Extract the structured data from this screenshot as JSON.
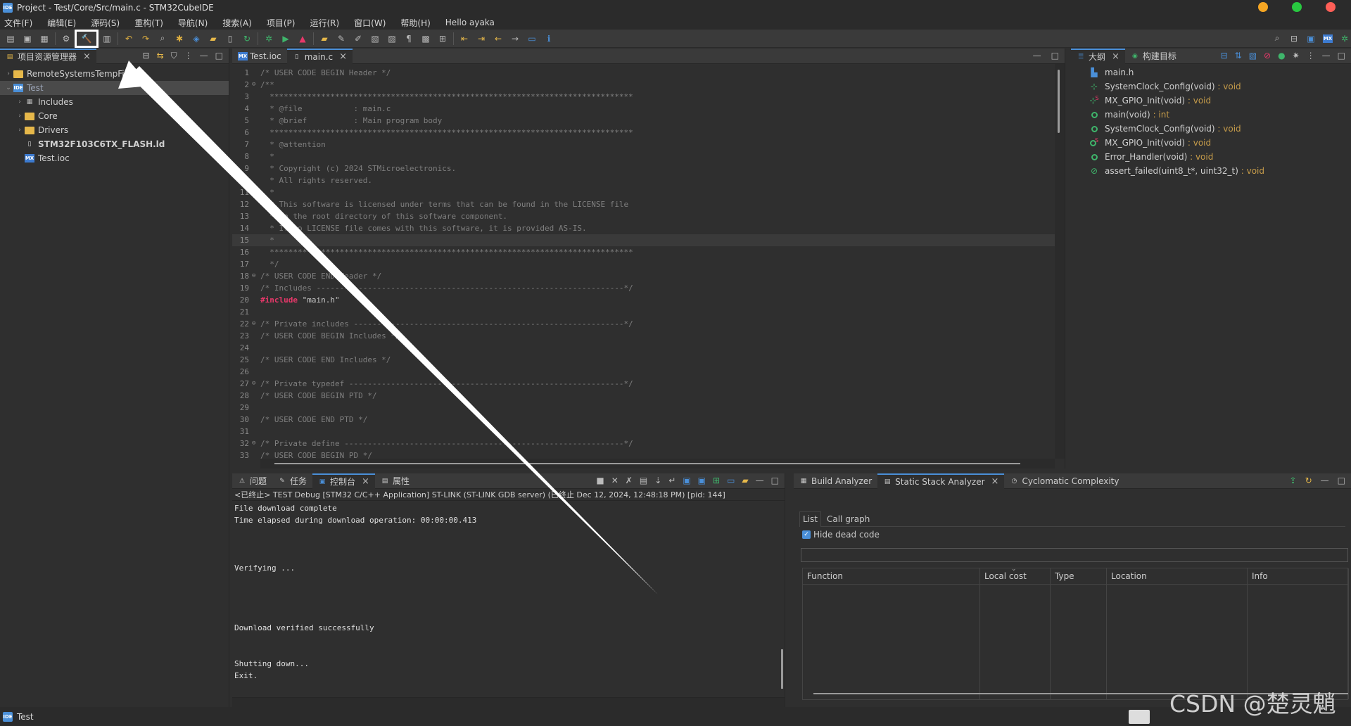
{
  "window": {
    "title": "Project - Test/Core/Src/main.c - STM32CubeIDE",
    "app_badge": "IDE",
    "controls": [
      "minimize",
      "maximize",
      "close"
    ],
    "control_colors": [
      "#f5a623",
      "#28c840",
      "#ff5f57"
    ]
  },
  "menu": [
    "文件(F)",
    "编辑(E)",
    "源码(S)",
    "重构(T)",
    "导航(N)",
    "搜索(A)",
    "项目(P)",
    "运行(R)",
    "窗口(W)",
    "帮助(H)",
    "Hello ayaka"
  ],
  "project_explorer": {
    "tab_label": "项目资源管理器",
    "items": [
      {
        "label": "RemoteSystemsTempFiles",
        "icon": "folder-icon",
        "level": 0,
        "caret": "›"
      },
      {
        "label": "Test",
        "icon": "ide-project-icon",
        "level": 0,
        "caret": "⌄",
        "selected": true
      },
      {
        "label": "Includes",
        "icon": "includes-icon",
        "level": 1,
        "caret": "›"
      },
      {
        "label": "Core",
        "icon": "folder-icon",
        "level": 1,
        "caret": "›"
      },
      {
        "label": "Drivers",
        "icon": "folder-icon",
        "level": 1,
        "caret": "›"
      },
      {
        "label": "STM32F103C6TX_FLASH.ld",
        "icon": "ld-file-icon",
        "level": 1,
        "caret": "",
        "bold": true
      },
      {
        "label": "Test.ioc",
        "icon": "mx-file-icon",
        "level": 1,
        "caret": ""
      }
    ]
  },
  "editor": {
    "tabs": [
      {
        "label": "Test.ioc",
        "icon": "mx-file-icon",
        "active": false
      },
      {
        "label": "main.c",
        "icon": "c-file-icon",
        "active": true
      }
    ],
    "lines": [
      {
        "n": "1",
        "fold": "",
        "text": "/* USER CODE BEGIN Header */"
      },
      {
        "n": "2",
        "fold": "⊖",
        "text": "/**"
      },
      {
        "n": "3",
        "fold": "",
        "text": "  ******************************************************************************"
      },
      {
        "n": "4",
        "fold": "",
        "text": "  * @file           : main.c"
      },
      {
        "n": "5",
        "fold": "",
        "text": "  * @brief          : Main program body"
      },
      {
        "n": "6",
        "fold": "",
        "text": "  ******************************************************************************"
      },
      {
        "n": "7",
        "fold": "",
        "text": "  * @attention"
      },
      {
        "n": "8",
        "fold": "",
        "text": "  *"
      },
      {
        "n": "9",
        "fold": "",
        "text": "  * Copyright (c) 2024 STMicroelectronics."
      },
      {
        "n": "10",
        "fold": "",
        "text": "  * All rights reserved."
      },
      {
        "n": "11",
        "fold": "",
        "text": "  *"
      },
      {
        "n": "12",
        "fold": "",
        "text": "  * This software is licensed under terms that can be found in the LICENSE file"
      },
      {
        "n": "13",
        "fold": "",
        "text": "  * in the root directory of this software component."
      },
      {
        "n": "14",
        "fold": "",
        "text": "  * If no LICENSE file comes with this software, it is provided AS-IS."
      },
      {
        "n": "15",
        "fold": "",
        "text": "  *"
      },
      {
        "n": "16",
        "fold": "",
        "text": "  ******************************************************************************"
      },
      {
        "n": "17",
        "fold": "",
        "text": "  */"
      },
      {
        "n": "18",
        "fold": "⊖",
        "text": "/* USER CODE END Header */"
      },
      {
        "n": "19",
        "fold": "",
        "text": "/* Includes ------------------------------------------------------------------*/"
      },
      {
        "n": "20",
        "fold": "",
        "text": "#include \"main.h\"",
        "kw": "#include",
        "rest": " \"main.h\""
      },
      {
        "n": "21",
        "fold": "",
        "text": ""
      },
      {
        "n": "22",
        "fold": "⊖",
        "text": "/* Private includes ----------------------------------------------------------*/"
      },
      {
        "n": "23",
        "fold": "",
        "text": "/* USER CODE BEGIN Includes */"
      },
      {
        "n": "24",
        "fold": "",
        "text": ""
      },
      {
        "n": "25",
        "fold": "",
        "text": "/* USER CODE END Includes */"
      },
      {
        "n": "26",
        "fold": "",
        "text": ""
      },
      {
        "n": "27",
        "fold": "⊖",
        "text": "/* Private typedef -----------------------------------------------------------*/"
      },
      {
        "n": "28",
        "fold": "",
        "text": "/* USER CODE BEGIN PTD */"
      },
      {
        "n": "29",
        "fold": "",
        "text": ""
      },
      {
        "n": "30",
        "fold": "",
        "text": "/* USER CODE END PTD */"
      },
      {
        "n": "31",
        "fold": "",
        "text": ""
      },
      {
        "n": "32",
        "fold": "⊖",
        "text": "/* Private define ------------------------------------------------------------*/"
      },
      {
        "n": "33",
        "fold": "",
        "text": "/* USER CODE BEGIN PD */"
      }
    ]
  },
  "outline": {
    "tabs": [
      {
        "label": "大纲",
        "active": true
      },
      {
        "label": "构建目标",
        "active": false
      }
    ],
    "items": [
      {
        "name": "main.h",
        "type": "",
        "icon": "include-icon"
      },
      {
        "name": "SystemClock_Config(void)",
        "type": " : void",
        "icon": "declaration-icon"
      },
      {
        "name": "MX_GPIO_Init(void)",
        "type": " : void",
        "icon": "static-declaration-icon"
      },
      {
        "name": "main(void)",
        "type": " : int",
        "icon": "function-icon"
      },
      {
        "name": "SystemClock_Config(void)",
        "type": " : void",
        "icon": "function-icon"
      },
      {
        "name": "MX_GPIO_Init(void)",
        "type": " : void",
        "icon": "static-function-icon"
      },
      {
        "name": "Error_Handler(void)",
        "type": " : void",
        "icon": "function-icon"
      },
      {
        "name": "assert_failed(uint8_t*, uint32_t)",
        "type": " : void",
        "icon": "disabled-function-icon"
      }
    ]
  },
  "console": {
    "tabs": [
      {
        "label": "问题",
        "active": false
      },
      {
        "label": "任务",
        "active": false
      },
      {
        "label": "控制台",
        "active": true
      },
      {
        "label": "属性",
        "active": false
      }
    ],
    "header": "<已终止> TEST Debug [STM32 C/C++ Application] ST-LINK (ST-LINK GDB server) (已终止 Dec 12, 2024, 12:48:18 PM) [pid: 144]",
    "lines": [
      "File download complete",
      "Time elapsed during download operation: 00:00:00.413",
      "",
      "",
      "",
      "Verifying ...",
      "",
      "",
      "",
      "",
      "Download verified successfully",
      "",
      "",
      "Shutting down...",
      "Exit."
    ]
  },
  "analyzer": {
    "tabs": [
      {
        "label": "Build Analyzer",
        "active": false
      },
      {
        "label": "Static Stack Analyzer",
        "active": true
      },
      {
        "label": "Cyclomatic Complexity",
        "active": false
      }
    ],
    "subtabs": [
      "List",
      "Call graph"
    ],
    "hide_dead_code_label": "Hide dead code",
    "hide_dead_code_checked": true,
    "filter_value": "",
    "columns": [
      "Function",
      "Local cost",
      "Type",
      "Location",
      "Info"
    ]
  },
  "statusbar": {
    "project": "Test"
  },
  "watermark": "CSDN @楚灵魈",
  "colors": {
    "accent": "#4a8fd8",
    "preprocessor": "#e8386a",
    "return_type": "#c69c4a",
    "function_icon": "#3fb56b",
    "annotation_arrow": "#ffffff"
  }
}
